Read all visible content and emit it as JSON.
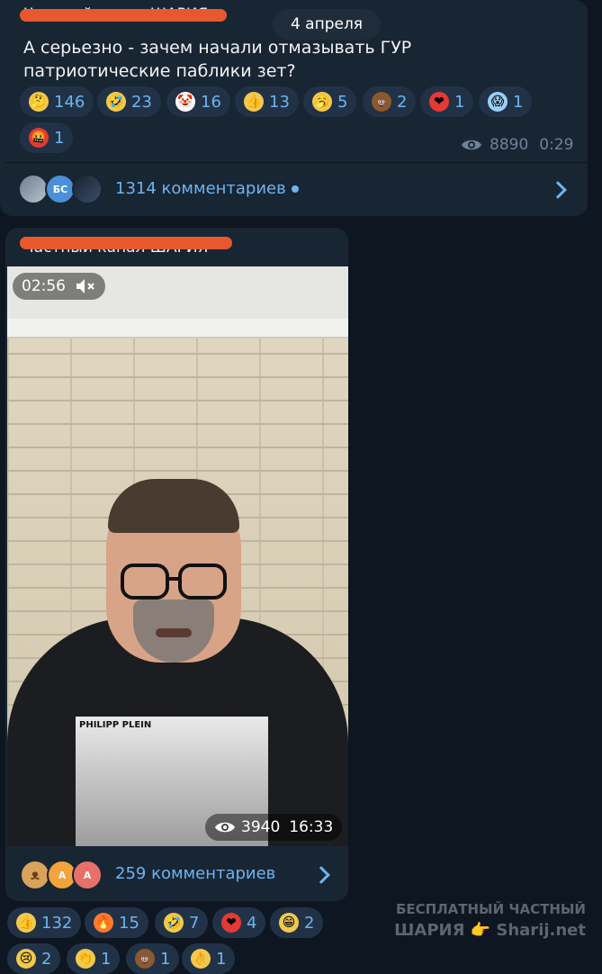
{
  "date_pill": "4 апреля",
  "post1": {
    "channel": "Частный канал ШАРИЯ",
    "text": "А серьезно - зачем начали отмазывать ГУР патриотические паблики зет?",
    "reactions": [
      {
        "emoji": "🤔",
        "count": "146",
        "color": "#f2c94c"
      },
      {
        "emoji": "🤣",
        "count": "23",
        "color": "#f2c94c"
      },
      {
        "emoji": "🤡",
        "count": "16",
        "color": "#ffffff"
      },
      {
        "emoji": "👍",
        "count": "13",
        "color": "#f2c94c"
      },
      {
        "emoji": "🥱",
        "count": "5",
        "color": "#f2c94c"
      },
      {
        "emoji": "💩",
        "count": "2",
        "color": "#8b5a2b"
      },
      {
        "emoji": "❤",
        "count": "1",
        "color": "#e53935"
      },
      {
        "emoji": "😱",
        "count": "1",
        "color": "#9ad0f5"
      },
      {
        "emoji": "🤬",
        "count": "1",
        "color": "#e53935"
      }
    ],
    "views": "8890",
    "time": "0:29",
    "comments": "1314 комментариев",
    "avatar_initials": "БС"
  },
  "post2": {
    "channel": "Частный канал ШАРИЯ",
    "video_duration": "02:56",
    "views": "3940",
    "time": "16:33",
    "shirt_print": "PHILIPP PLEIN",
    "comments": "259 комментариев",
    "avatar_a": "А",
    "avatar_b": "А",
    "reactions": [
      {
        "emoji": "👍",
        "count": "132",
        "color": "#f2c94c"
      },
      {
        "emoji": "🔥",
        "count": "15",
        "color": "#ff7a2f"
      },
      {
        "emoji": "🤣",
        "count": "7",
        "color": "#f2c94c"
      },
      {
        "emoji": "❤",
        "count": "4",
        "color": "#e53935"
      },
      {
        "emoji": "😁",
        "count": "2",
        "color": "#f2c94c"
      }
    ],
    "reactions_row2": [
      {
        "emoji": "😢",
        "count": "2",
        "color": "#f2c94c"
      },
      {
        "emoji": "👏",
        "count": "1",
        "color": "#f2c94c"
      },
      {
        "emoji": "💩",
        "count": "1",
        "color": "#8b5a2b"
      },
      {
        "emoji": "👌",
        "count": "1",
        "color": "#f2c94c"
      }
    ]
  },
  "watermark": {
    "line1": "БЕСПЛАТНЫЙ ЧАСТНЫЙ",
    "line2": "ШАРИЯ 👉 Sharij.net"
  },
  "icons": {
    "views": "eye-icon",
    "mute": "mute-icon",
    "comments_arrow": "chevron-right-icon"
  }
}
